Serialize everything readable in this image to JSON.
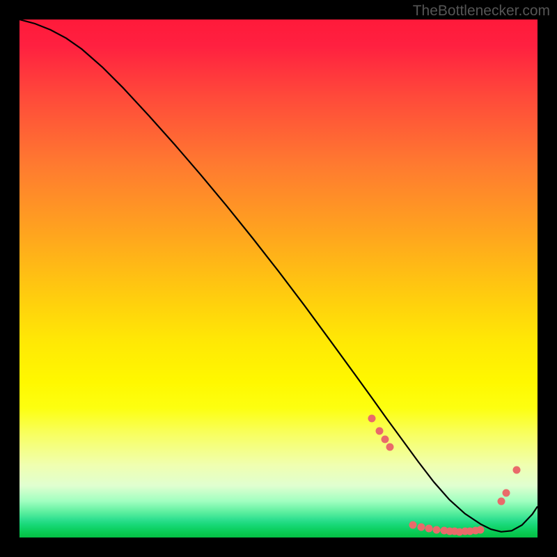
{
  "watermark": "TheBottlenecker.com",
  "chart_data": {
    "type": "line",
    "title": "",
    "xlabel": "",
    "ylabel": "",
    "xlim": [
      0,
      100
    ],
    "ylim": [
      0,
      100
    ],
    "series": [
      {
        "name": "curve",
        "x": [
          0,
          3,
          6,
          9,
          12,
          16,
          20,
          25,
          30,
          35,
          40,
          45,
          50,
          55,
          60,
          64,
          68,
          71,
          74,
          77,
          80,
          83,
          86,
          89,
          91,
          93,
          95,
          97,
          99,
          100
        ],
        "y": [
          100,
          99.2,
          98,
          96.4,
          94.3,
          90.8,
          86.8,
          81.4,
          75.8,
          70,
          64,
          57.8,
          51.4,
          44.8,
          38,
          32.5,
          27,
          22.8,
          18.7,
          14.6,
          10.7,
          7.3,
          4.6,
          2.6,
          1.6,
          1.1,
          1.3,
          2.4,
          4.5,
          6.0
        ]
      }
    ],
    "markers": [
      {
        "x": 68.0,
        "y": 23.0
      },
      {
        "x": 69.5,
        "y": 20.5
      },
      {
        "x": 70.5,
        "y": 19.0
      },
      {
        "x": 71.5,
        "y": 17.5
      },
      {
        "x": 76.0,
        "y": 2.4
      },
      {
        "x": 77.5,
        "y": 2.0
      },
      {
        "x": 79.0,
        "y": 1.7
      },
      {
        "x": 80.5,
        "y": 1.5
      },
      {
        "x": 82.0,
        "y": 1.3
      },
      {
        "x": 83.0,
        "y": 1.2
      },
      {
        "x": 84.0,
        "y": 1.15
      },
      {
        "x": 85.0,
        "y": 1.1
      },
      {
        "x": 86.0,
        "y": 1.15
      },
      {
        "x": 87.0,
        "y": 1.2
      },
      {
        "x": 88.0,
        "y": 1.3
      },
      {
        "x": 89.0,
        "y": 1.45
      },
      {
        "x": 93.0,
        "y": 7.0
      },
      {
        "x": 94.0,
        "y": 8.6
      },
      {
        "x": 96.0,
        "y": 13.0
      }
    ],
    "gradient_stops": [
      {
        "t": 0.0,
        "color": "#ff1a3a"
      },
      {
        "t": 0.4,
        "color": "#ffa020"
      },
      {
        "t": 0.7,
        "color": "#fff800"
      },
      {
        "t": 0.95,
        "color": "#60f0a0"
      },
      {
        "t": 1.0,
        "color": "#05c045"
      }
    ]
  }
}
